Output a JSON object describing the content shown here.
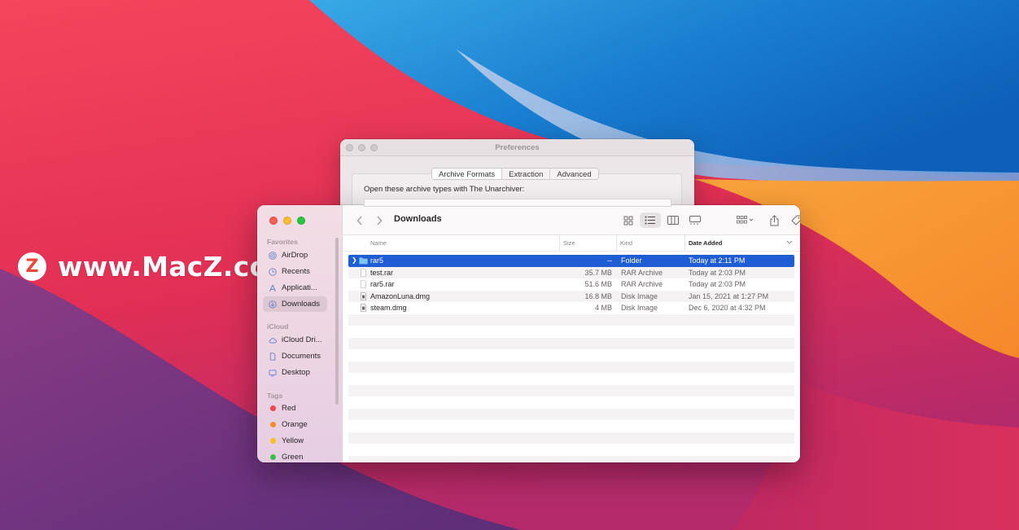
{
  "watermark": {
    "badge": "Z",
    "text": "www.MacZ.com"
  },
  "preferences": {
    "title": "Preferences",
    "tabs": [
      "Archive Formats",
      "Extraction",
      "Advanced"
    ],
    "active_tab": "Archive Formats",
    "prompt": "Open these archive types with The Unarchiver:"
  },
  "finder": {
    "title": "Downloads",
    "sidebar": {
      "favorites_header": "Favorites",
      "favorites": [
        {
          "label": "AirDrop",
          "icon": "airdrop-icon"
        },
        {
          "label": "Recents",
          "icon": "clock-icon"
        },
        {
          "label": "Applicati...",
          "icon": "applications-icon"
        },
        {
          "label": "Downloads",
          "icon": "download-icon",
          "selected": true
        }
      ],
      "icloud_header": "iCloud",
      "icloud": [
        {
          "label": "iCloud Dri...",
          "icon": "cloud-icon"
        },
        {
          "label": "Documents",
          "icon": "document-icon"
        },
        {
          "label": "Desktop",
          "icon": "desktop-icon"
        }
      ],
      "tags_header": "Tags",
      "tags": [
        {
          "label": "Red",
          "color": "#f2444d"
        },
        {
          "label": "Orange",
          "color": "#f58b2a"
        },
        {
          "label": "Yellow",
          "color": "#f5c21c"
        },
        {
          "label": "Green",
          "color": "#3bbf4b"
        }
      ]
    },
    "columns": {
      "name": "Name",
      "size": "Size",
      "kind": "Kind",
      "date": "Date Added"
    },
    "files": [
      {
        "name": "rar5",
        "size": "--",
        "kind": "Folder",
        "date": "Today at 2:11 PM",
        "type": "folder",
        "selected": true
      },
      {
        "name": "test.rar",
        "size": "35.7 MB",
        "kind": "RAR Archive",
        "date": "Today at 2:03 PM",
        "type": "file"
      },
      {
        "name": "rar5.rar",
        "size": "51.6 MB",
        "kind": "RAR Archive",
        "date": "Today at 2:03 PM",
        "type": "file"
      },
      {
        "name": "AmazonLuna.dmg",
        "size": "16.8 MB",
        "kind": "Disk Image",
        "date": "Jan 15, 2021 at 1:27 PM",
        "type": "dmg"
      },
      {
        "name": "steam.dmg",
        "size": "4 MB",
        "kind": "Disk Image",
        "date": "Dec 6, 2020 at 4:32 PM",
        "type": "dmg"
      }
    ]
  }
}
